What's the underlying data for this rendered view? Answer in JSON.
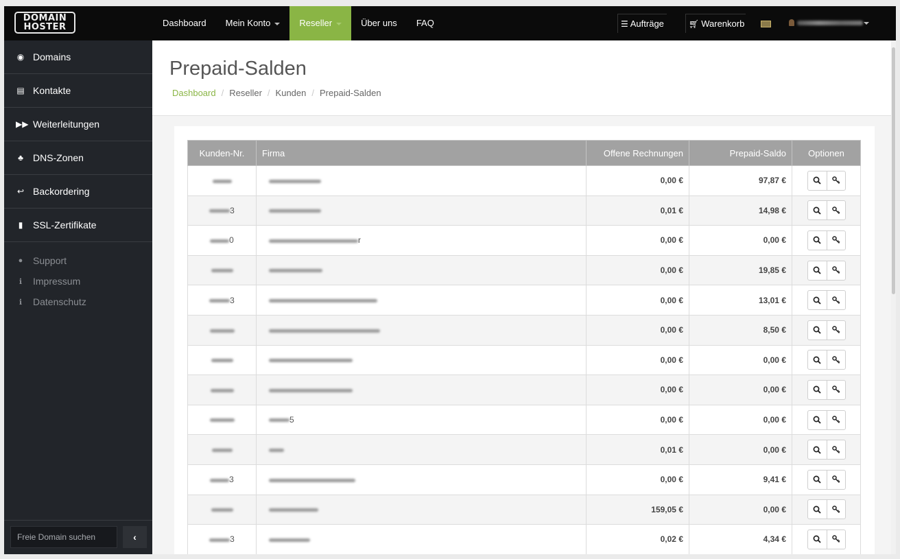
{
  "logo": {
    "line1": "DOMAIN",
    "line2": "HOSTER"
  },
  "nav": [
    {
      "label": "Dashboard",
      "dropdown": false,
      "active": false
    },
    {
      "label": "Mein Konto",
      "dropdown": true,
      "active": false
    },
    {
      "label": "Reseller",
      "dropdown": true,
      "active": true
    },
    {
      "label": "Über uns",
      "dropdown": false,
      "active": false
    },
    {
      "label": "FAQ",
      "dropdown": false,
      "active": false
    }
  ],
  "topright": {
    "orders_label": "Aufträge",
    "cart_label": "Warenkorb"
  },
  "sidebar": {
    "items": [
      {
        "label": "Domains",
        "icon": "globe-icon",
        "glyph": "◉"
      },
      {
        "label": "Kontakte",
        "icon": "id-card-icon",
        "glyph": "▤"
      },
      {
        "label": "Weiterleitungen",
        "icon": "fast-forward-icon",
        "glyph": "▶▶"
      },
      {
        "label": "DNS-Zonen",
        "icon": "sitemap-icon",
        "glyph": "♣"
      },
      {
        "label": "Backordering",
        "icon": "reply-icon",
        "glyph": "↩"
      },
      {
        "label": "SSL-Zertifikate",
        "icon": "lock-icon",
        "glyph": "▮"
      }
    ],
    "subitems": [
      {
        "label": "Support",
        "icon": "comments-icon",
        "glyph": "●"
      },
      {
        "label": "Impressum",
        "icon": "info-icon",
        "glyph": "ℹ"
      },
      {
        "label": "Datenschutz",
        "icon": "info-icon",
        "glyph": "ℹ"
      }
    ],
    "search_placeholder": "Freie Domain suchen",
    "collapse_glyph": "‹"
  },
  "page": {
    "title": "Prepaid-Salden",
    "breadcrumb": [
      "Dashboard",
      "Reseller",
      "Kunden",
      "Prepaid-Salden"
    ]
  },
  "table": {
    "headers": [
      "Kunden-Nr.",
      "Firma",
      "Offene Rechnungen",
      "Prepaid-Saldo",
      "Optionen"
    ],
    "rows": [
      {
        "nr_suffix": "",
        "firma_suffix": "",
        "offen": "0,00 €",
        "saldo": "97,87 €"
      },
      {
        "nr_suffix": "3",
        "firma_suffix": "",
        "offen": "0,01 €",
        "saldo": "14,98 €"
      },
      {
        "nr_suffix": "0",
        "firma_suffix": "r",
        "offen": "0,00 €",
        "saldo": "0,00 €"
      },
      {
        "nr_suffix": "",
        "firma_suffix": "",
        "offen": "0,00 €",
        "saldo": "19,85 €"
      },
      {
        "nr_suffix": "3",
        "firma_suffix": "",
        "offen": "0,00 €",
        "saldo": "13,01 €"
      },
      {
        "nr_suffix": "",
        "firma_suffix": "",
        "offen": "0,00 €",
        "saldo": "8,50 €"
      },
      {
        "nr_suffix": "",
        "firma_suffix": "",
        "offen": "0,00 €",
        "saldo": "0,00 €"
      },
      {
        "nr_suffix": "",
        "firma_suffix": "",
        "offen": "0,00 €",
        "saldo": "0,00 €"
      },
      {
        "nr_suffix": "",
        "firma_suffix": "5",
        "offen": "0,00 €",
        "saldo": "0,00 €"
      },
      {
        "nr_suffix": "",
        "firma_suffix": "",
        "offen": "0,01 €",
        "saldo": "0,00 €"
      },
      {
        "nr_suffix": "3",
        "firma_suffix": "",
        "offen": "0,00 €",
        "saldo": "9,41 €"
      },
      {
        "nr_suffix": "",
        "firma_suffix": "",
        "offen": "159,05 €",
        "saldo": "0,00 €"
      },
      {
        "nr_suffix": "3",
        "firma_suffix": "",
        "offen": "0,02 €",
        "saldo": "4,34 €"
      }
    ],
    "option_icons": [
      "search-icon",
      "key-icon"
    ]
  },
  "colors": {
    "accent": "#8ab545",
    "topbar": "#0b0b0b",
    "sidebar": "#22252a",
    "table_header": "#a2a2a2"
  }
}
